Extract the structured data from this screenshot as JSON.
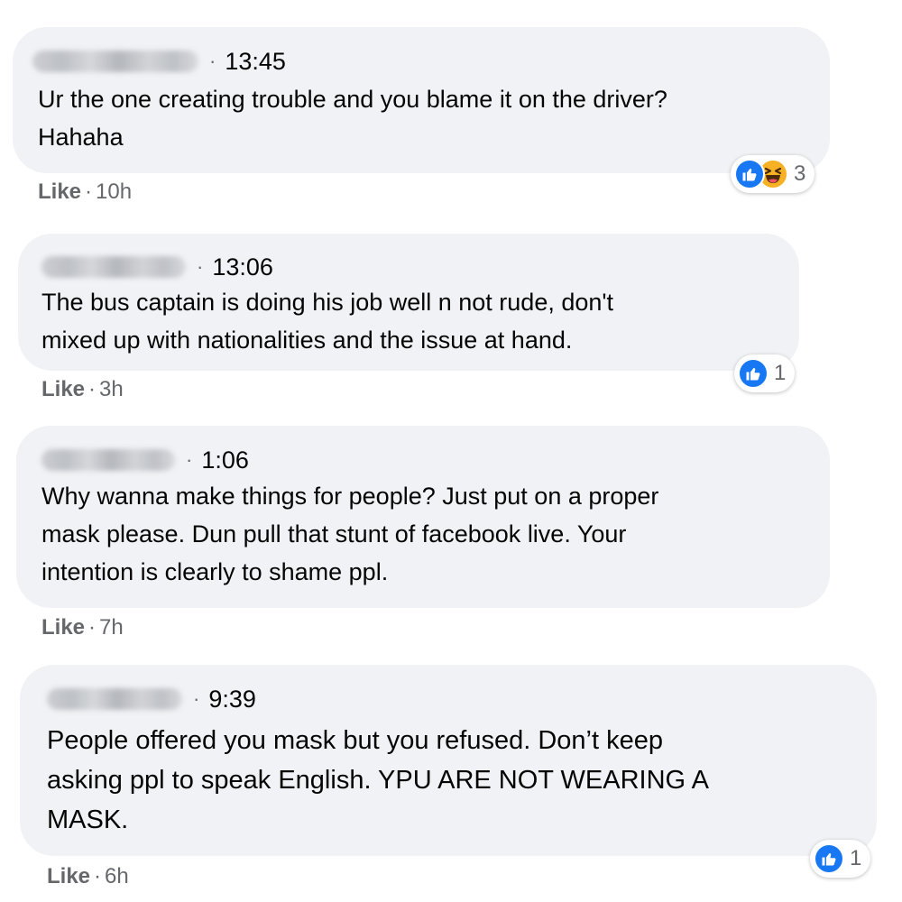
{
  "comments": [
    {
      "time": "13:45",
      "lines": [
        "Ur the one creating trouble and you blame it on the driver?",
        "Hahaha"
      ],
      "like_label": "Like",
      "age": "10h",
      "reaction_count": "3",
      "reactions": [
        "like-icon",
        "haha-icon"
      ]
    },
    {
      "time": "13:06",
      "lines": [
        "The bus captain is doing his job well n not rude, don't",
        "mixed up with nationalities and the issue at hand."
      ],
      "like_label": "Like",
      "age": "3h",
      "reaction_count": "1",
      "reactions": [
        "like-icon"
      ]
    },
    {
      "time": "1:06",
      "lines": [
        "Why wanna make things for people? Just put on a proper",
        "mask please. Dun pull that stunt of facebook live. Your",
        "intention is clearly to shame ppl."
      ],
      "like_label": "Like",
      "age": "7h",
      "reaction_count": "",
      "reactions": []
    },
    {
      "time": "9:39",
      "lines": [
        "People offered you mask but you refused. Don’t keep",
        "asking ppl to speak English. YPU ARE NOT WEARING A",
        "MASK."
      ],
      "like_label": "Like",
      "age": "6h",
      "reaction_count": "1",
      "reactions": [
        "like-icon"
      ]
    }
  ],
  "separator": "·",
  "colors": {
    "bubble": "#f0f2f5",
    "like_blue": "#1877f2",
    "haha_yellow": "#f7b125",
    "secondary_text": "#65676b"
  }
}
